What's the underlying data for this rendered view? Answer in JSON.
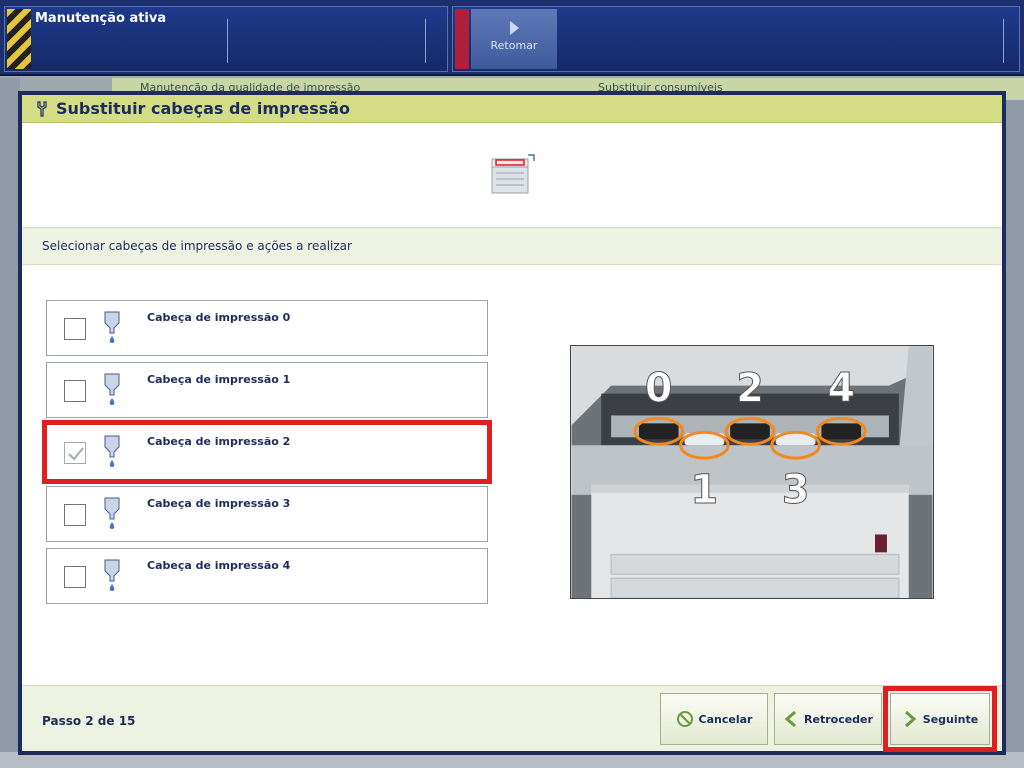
{
  "topbar": {
    "status_title": "Manutenção ativa",
    "resume_label": "Retomar"
  },
  "background": {
    "header_left": "Manutenção da qualidade de impressão",
    "header_right": "Substituir consumíveis"
  },
  "dialog": {
    "title": "Substituir cabeças de impressão",
    "section_label": "Selecionar cabeças de impressão e ações a realizar",
    "heads": [
      {
        "label": "Cabeça de impressão 0",
        "checked": false
      },
      {
        "label": "Cabeça de impressão 1",
        "checked": false
      },
      {
        "label": "Cabeça de impressão 2",
        "checked": true
      },
      {
        "label": "Cabeça de impressão 3",
        "checked": false
      },
      {
        "label": "Cabeça de impressão 4",
        "checked": false
      }
    ],
    "photo_numbers": [
      "0",
      "1",
      "2",
      "3",
      "4"
    ],
    "step": "Passo 2 de 15",
    "buttons": {
      "cancel": "Cancelar",
      "back": "Retroceder",
      "next": "Seguinte"
    }
  },
  "colors": {
    "title_bar": "#d4dc86",
    "highlight": "#e02020",
    "navy": "#1d2c5c"
  }
}
